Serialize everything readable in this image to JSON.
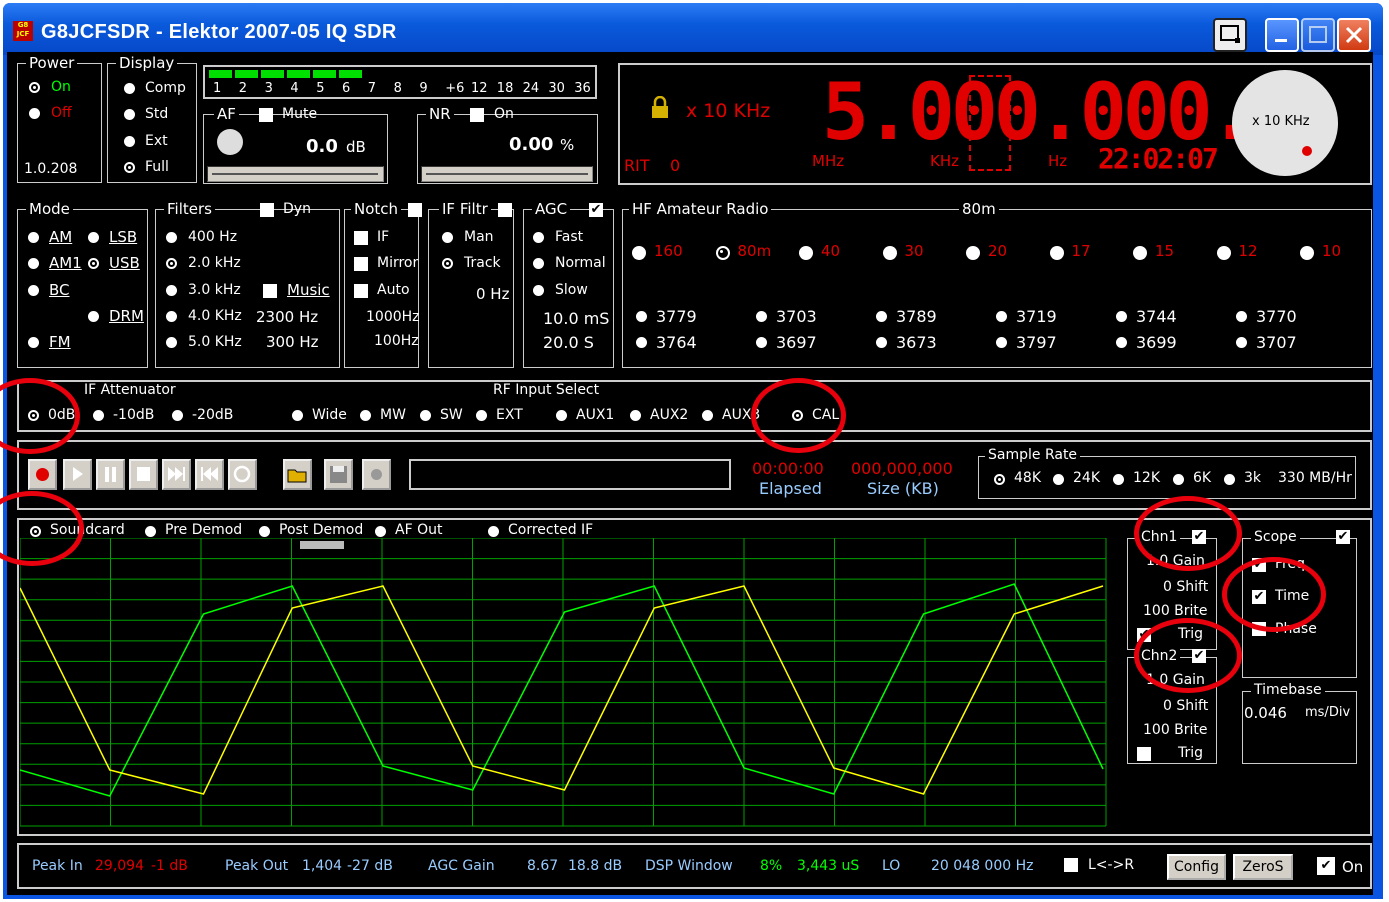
{
  "window": {
    "title": "G8JCFSDR - Elektor 2007-05 IQ SDR",
    "icon_text": "G8 JCF"
  },
  "power": {
    "label": "Power",
    "on": "On",
    "off": "Off",
    "version": "1.0.208"
  },
  "display": {
    "label": "Display",
    "options": [
      "Comp",
      "Std",
      "Ext",
      "Full"
    ],
    "selected": "Full"
  },
  "meter": {
    "scale": [
      "1",
      "2",
      "3",
      "4",
      "5",
      "6",
      "7",
      "8",
      "9",
      "+6",
      "12",
      "18",
      "24",
      "30",
      "36"
    ],
    "level_fraction": 0.4
  },
  "af": {
    "label": "AF",
    "mute": "Mute",
    "value": "0.0",
    "unit": "dB"
  },
  "nr": {
    "label": "NR",
    "on": "On",
    "value": "0.00",
    "unit": "%"
  },
  "freq": {
    "step": "x 10 KHz",
    "display": "5.000.000.0",
    "mhz": "MHz",
    "khz": "KHz",
    "hz": "Hz",
    "rit_label": "RIT",
    "rit_value": "0",
    "time": "22:02:07",
    "knob_label": "x 10 KHz"
  },
  "mode": {
    "label": "Mode",
    "items": [
      "AM",
      "LSB",
      "AM1",
      "USB",
      "BC",
      "DRM",
      "FM"
    ],
    "selected": "USB"
  },
  "filters": {
    "label": "Filters",
    "dyn": "Dyn",
    "items": [
      "400 Hz",
      "2.0 kHz",
      "3.0 kHz",
      "4.0 KHz",
      "5.0 KHz"
    ],
    "selected": "2.0 kHz",
    "music": "Music",
    "val1": "2300 Hz",
    "val2": "300 Hz"
  },
  "notch": {
    "label": "Notch",
    "items": [
      "IF",
      "Mirror",
      "Auto"
    ],
    "val1": "1000Hz",
    "val2": "100Hz"
  },
  "iffilt": {
    "label": "IF Filtr",
    "items": [
      "Man",
      "Track"
    ],
    "selected": "Track",
    "value": "0 Hz"
  },
  "agc": {
    "label": "AGC",
    "items": [
      "Fast",
      "Normal",
      "Slow"
    ],
    "val1": "10.0 mS",
    "val2": "20.0 S"
  },
  "hf": {
    "label": "HF Amateur Radio",
    "band_label": "80m",
    "bands": [
      "160",
      "80m",
      "40",
      "30",
      "20",
      "17",
      "15",
      "12",
      "10"
    ],
    "selected": "80m",
    "memories": [
      "3779",
      "3703",
      "3789",
      "3719",
      "3744",
      "3770",
      "3764",
      "3697",
      "3673",
      "3797",
      "3699",
      "3707"
    ]
  },
  "ifatt": {
    "label": "IF Attenuator",
    "items": [
      "0dB",
      "-10dB",
      "-20dB"
    ],
    "selected": "0dB"
  },
  "rfin": {
    "label": "RF Input Select",
    "items": [
      "Wide",
      "MW",
      "SW",
      "EXT",
      "AUX1",
      "AUX2",
      "AUX3",
      "CAL"
    ],
    "selected": "CAL"
  },
  "record": {
    "elapsed_value": "00:00:00",
    "elapsed_label": "Elapsed",
    "size_value": "000,000,000",
    "size_label": "Size (KB)"
  },
  "samplerate": {
    "label": "Sample Rate",
    "items": [
      "48K",
      "24K",
      "12K",
      "6K",
      "3k"
    ],
    "selected": "48K",
    "rate": "330 MB/Hr"
  },
  "scope_src": {
    "items": [
      "Soundcard",
      "Pre Demod",
      "Post Demod",
      "AF Out",
      "Corrected IF"
    ],
    "selected": "Soundcard"
  },
  "chn1": {
    "label": "Chn1",
    "gain": "1.0 Gain",
    "shift": "0 Shift",
    "brite": "100 Brite",
    "trig": "Trig"
  },
  "chn2": {
    "label": "Chn2",
    "gain": "1.0 Gain",
    "shift": "0 Shift",
    "brite": "100 Brite",
    "trig": "Trig"
  },
  "scope": {
    "label": "Scope",
    "items": [
      "Freq",
      "Time",
      "Phase"
    ],
    "checked": "Time"
  },
  "timebase": {
    "label": "Timebase",
    "value": "0.046",
    "unit": "ms/Div"
  },
  "status": {
    "peak_in_label": "Peak In",
    "peak_in_value": "29,094",
    "peak_in_db": "-1 dB",
    "peak_out_label": "Peak Out",
    "peak_out_value": "1,404",
    "peak_out_db": "-27 dB",
    "agc_label": "AGC Gain",
    "agc_value": "8.67",
    "agc_db": "18.8 dB",
    "dsp_label": "DSP Window",
    "dsp_pct": "8%",
    "dsp_us": "3,443 uS",
    "lo_label": "LO",
    "lo_value": "20 048 000 Hz",
    "swap": "L<->R",
    "config": "Config",
    "zeros": "ZeroS",
    "on": "On"
  },
  "colors": {
    "accent_red": "#e00000",
    "trace_green": "#00ff00",
    "trace_yellow": "#ffff00",
    "grid": "#00a000",
    "annotation": "#e8000c"
  }
}
